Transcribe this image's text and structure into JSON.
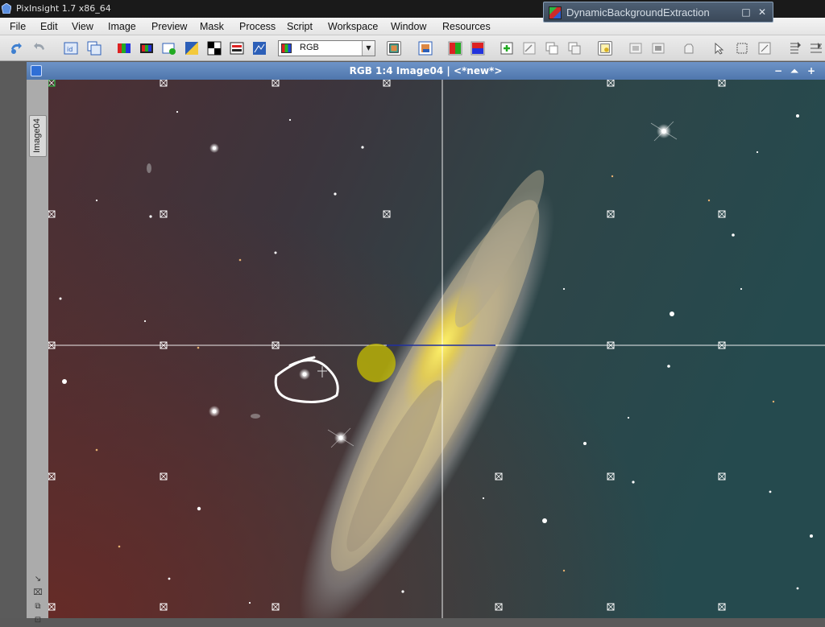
{
  "app": {
    "title": "PixInsight 1.7 x86_64"
  },
  "dbe_window": {
    "title": "DynamicBackgroundExtraction",
    "restore_glyph": "□",
    "close_glyph": "✕"
  },
  "menubar": {
    "items": [
      "File",
      "Edit",
      "View",
      "Image",
      "Preview",
      "Mask",
      "Process",
      "Script",
      "Workspace",
      "Window",
      "Resources"
    ]
  },
  "toolbar": {
    "channel_select": {
      "value": "RGB"
    }
  },
  "image_window": {
    "title": "RGB 1:4 Image04 | <*new*>",
    "tab_label": "Image04",
    "buttons": {
      "minimize": "−",
      "shade": "⏶",
      "maximize": "+"
    }
  },
  "side_tools": [
    "↘",
    "⌧",
    "⧉",
    "⊡"
  ],
  "colors": {
    "sample_marker": "#ffffff",
    "highlight_circle": "#ffffff",
    "yellow_sample": "#c8c000",
    "crosshair": "#ffffff"
  }
}
